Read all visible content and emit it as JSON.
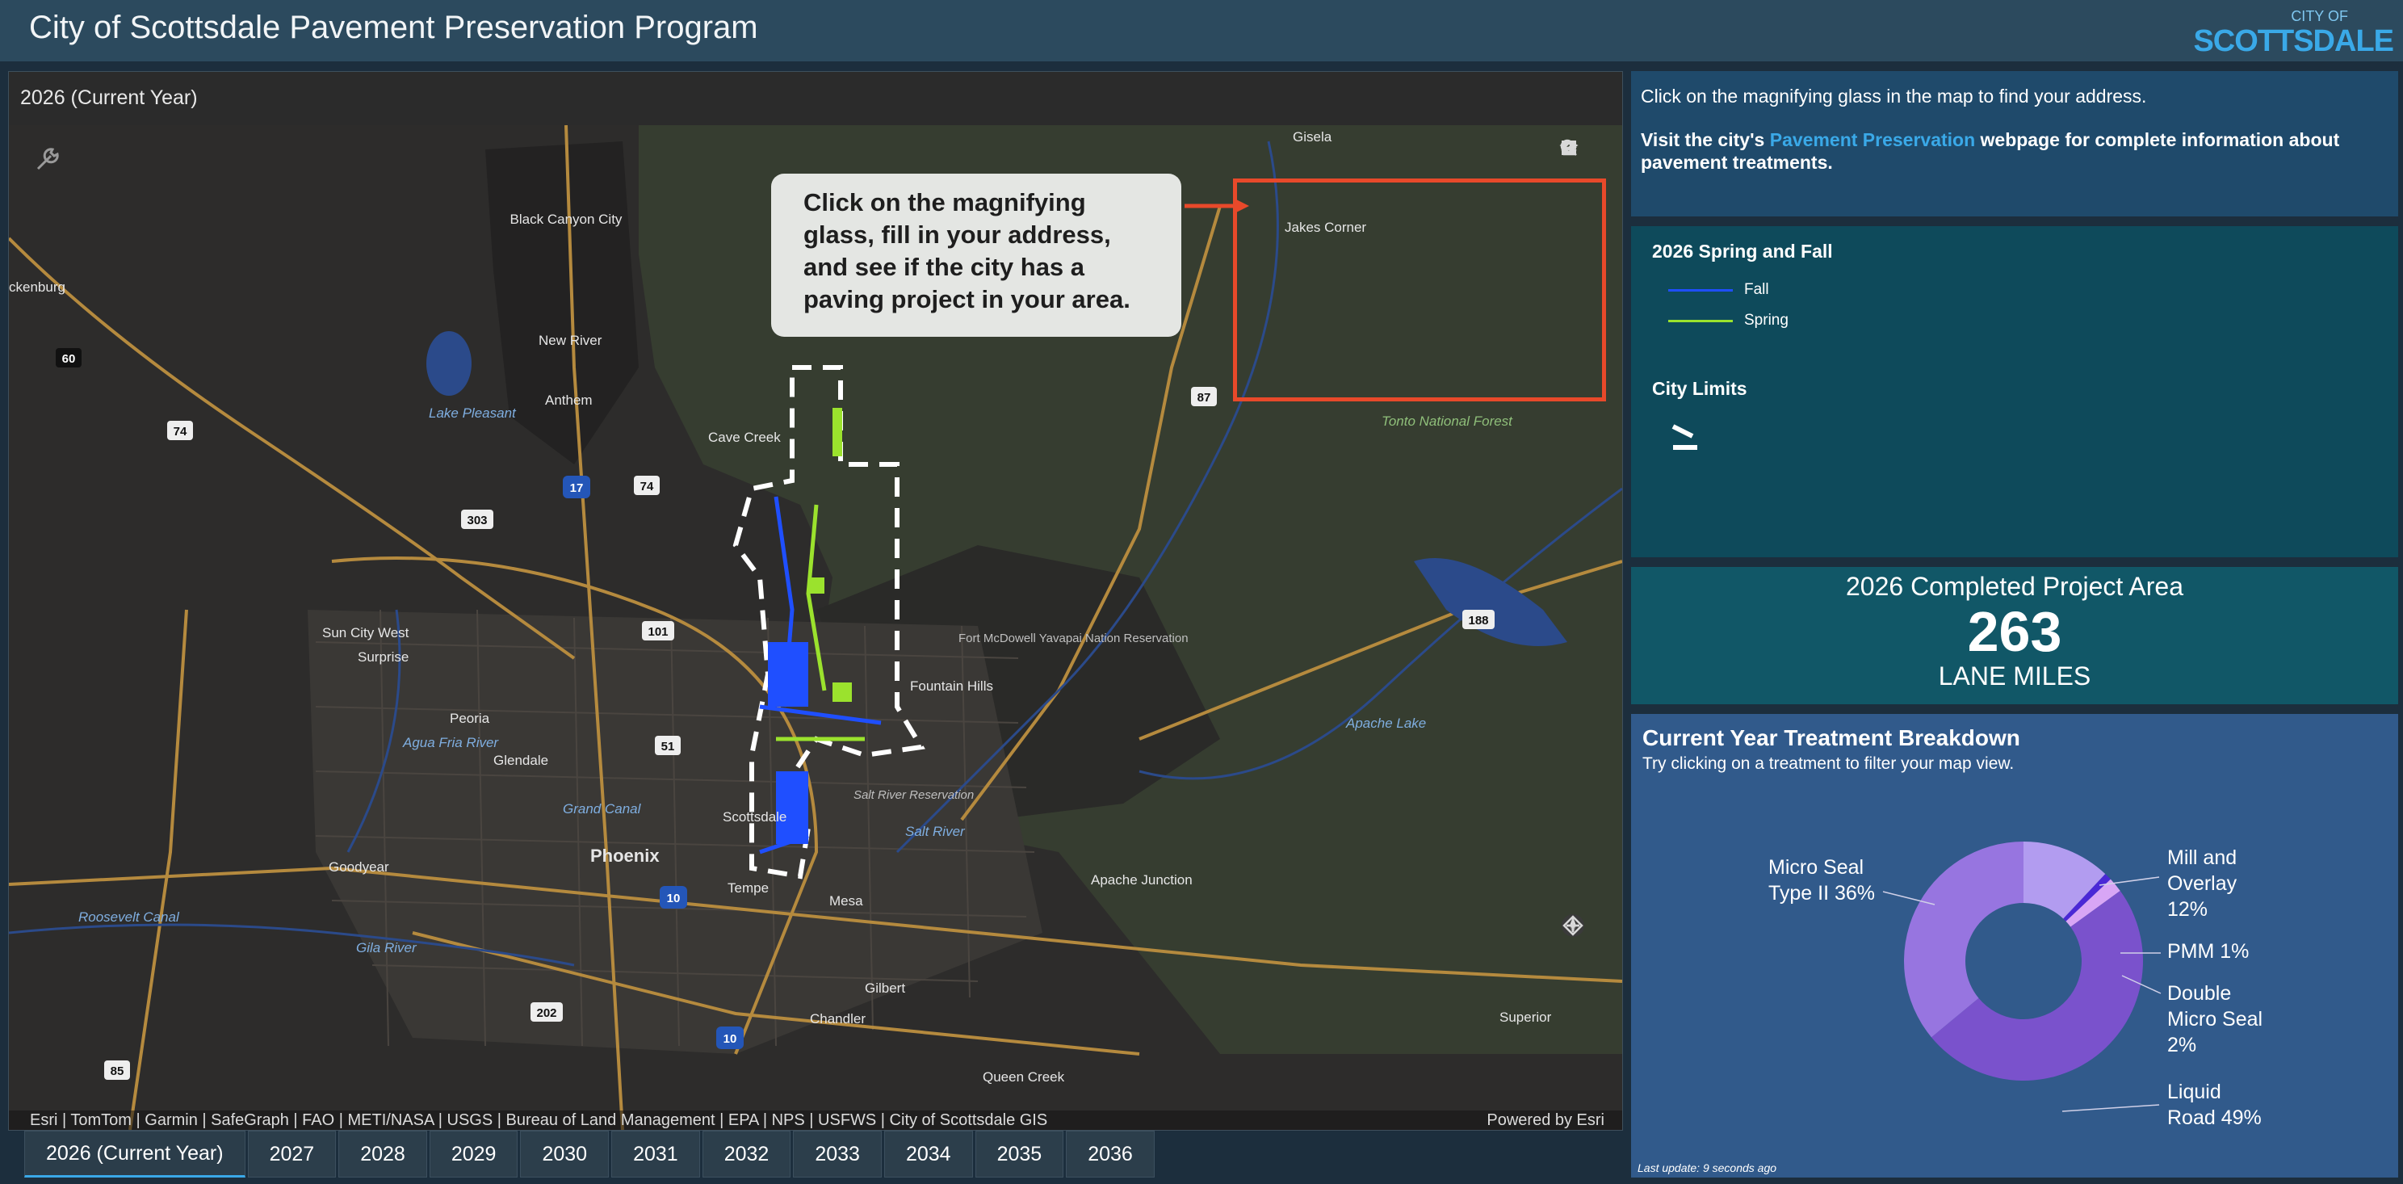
{
  "app": {
    "title": "City of Scottsdale Pavement Preservation Program",
    "logo_line1": "CITY OF",
    "logo_line2": "SCOTTSDALE"
  },
  "map_panel": {
    "title": "2026 (Current Year)",
    "callout": "Click on the magnifying glass, fill in your address, and see if the city has a paving project in your area.",
    "attribution": "Esri | TomTom | Garmin | SafeGraph | FAO | METI/NASA | USGS | Bureau of Land Management | EPA | NPS | USFWS | City of Scottsdale GIS",
    "powered_by": "Powered by Esri",
    "labels": {
      "black_canyon": "Black Canyon City",
      "gisela": "Gisela",
      "jakes_corner": "Jakes Corner",
      "new_river": "New River",
      "anthem": "Anthem",
      "cave_creek": "Cave Creek",
      "lake_pleasant": "Lake Pleasant",
      "tonto": "Tonto National Forest",
      "sun_city_west": "Sun City West",
      "surprise": "Surprise",
      "peoria": "Peoria",
      "glendale": "Glendale",
      "phoenix": "Phoenix",
      "goodyear": "Goodyear",
      "tempe": "Tempe",
      "mesa": "Mesa",
      "scottsdale": "Scottsdale",
      "fountain_hills": "Fountain Hills",
      "fort_mcdowell": "Fort McDowell Yavapai Nation Reservation",
      "salt_river_res": "Salt River Reservation",
      "salt_river": "Salt River",
      "apache_junction": "Apache Junction",
      "apache_lake": "Apache Lake",
      "gilbert": "Gilbert",
      "chandler": "Chandler",
      "queen_creek": "Queen Creek",
      "superior": "Superior",
      "roosevelt_canal": "Roosevelt Canal",
      "gila_river": "Gila River",
      "grand_canal": "Grand Canal",
      "agua_fria": "Agua Fria River",
      "wickenburg": "ckenburg",
      "shield_60": "60",
      "shield_74a": "74",
      "shield_74b": "74",
      "shield_17": "17",
      "shield_303": "303",
      "shield_101": "101",
      "shield_51": "51",
      "shield_10a": "10",
      "shield_10b": "10",
      "shield_202": "202",
      "shield_85": "85",
      "shield_87": "87",
      "shield_188": "188"
    }
  },
  "year_tabs": [
    "2026 (Current Year)",
    "2027",
    "2028",
    "2029",
    "2030",
    "2031",
    "2032",
    "2033",
    "2034",
    "2035",
    "2036"
  ],
  "info": {
    "line1": "Click on the magnifying glass in the map to find your address.",
    "visit_prefix": "Visit the city's ",
    "link_text": "Pavement Preservation",
    "visit_suffix": " webpage for complete information about pavement treatments."
  },
  "legend": {
    "section1_title": "2026 Spring and Fall",
    "fall": "Fall",
    "spring": "Spring",
    "section2_title": "City Limits",
    "colors": {
      "fall": "#1f4fff",
      "spring": "#9be22d",
      "city_limits": "#ffffff"
    }
  },
  "metric": {
    "title": "2026 Completed Project Area",
    "value": "263",
    "unit": "LANE MILES"
  },
  "breakdown": {
    "title": "Current Year Treatment Breakdown",
    "subtitle": "Try clicking on a treatment to filter your map view.",
    "last_update": "Last update: 9 seconds ago"
  },
  "chart_data": {
    "type": "pie",
    "title": "Current Year Treatment Breakdown",
    "slices": [
      {
        "label": "Mill and Overlay",
        "display": "12%",
        "value": 12,
        "color": "#b29cf0"
      },
      {
        "label": "PMM",
        "display": "1%",
        "value": 1,
        "color": "#4a28d6"
      },
      {
        "label": "Double Micro Seal",
        "display": "2%",
        "value": 2,
        "color": "#d8a6f5"
      },
      {
        "label": "Liquid Road",
        "display": "49%",
        "value": 49,
        "color": "#7a52cc"
      },
      {
        "label": "Micro Seal Type II",
        "display": "36%",
        "value": 36,
        "color": "#9775e0"
      }
    ],
    "label_lines": {
      "mill_1": "Mill and",
      "mill_2": "Overlay",
      "mill_3": "12%",
      "pmm": "PMM 1%",
      "double_1": "Double",
      "double_2": "Micro Seal",
      "double_3": "2%",
      "liquid_1": "Liquid",
      "liquid_2": "Road 49%",
      "micro_1": "Micro Seal",
      "micro_2": "Type II 36%"
    }
  }
}
